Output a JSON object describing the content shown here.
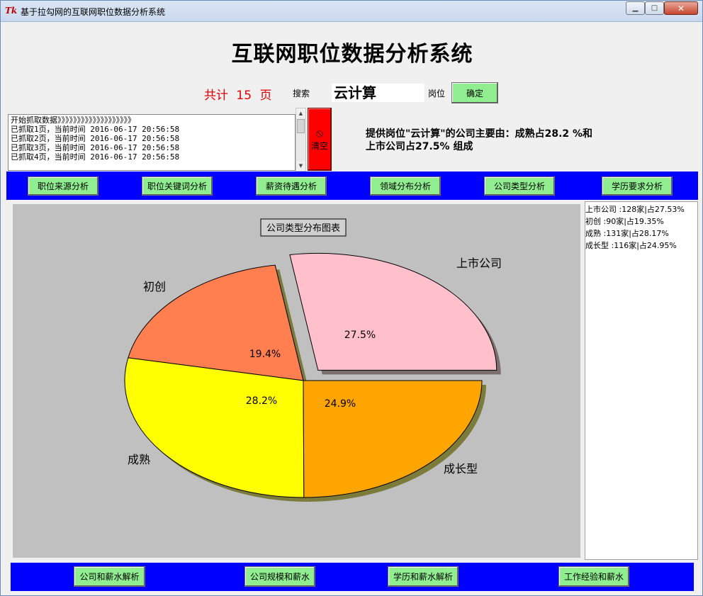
{
  "window": {
    "title": "基于拉勾网的互联网职位数据分析系统",
    "icon_label": "Tk",
    "controls": {
      "minimize": "▁",
      "maximize": "□",
      "close": "✕"
    }
  },
  "header": {
    "title": "互联网职位数据分析系统"
  },
  "search": {
    "page_count": "共计 15 页",
    "search_label": "搜索",
    "query_value": "云计算",
    "position_label": "岗位",
    "confirm_label": "确定"
  },
  "log": {
    "lines": [
      "开始抓取数据》》》》》》》》》》》》》》》》》》》",
      "已抓取1页，当前时间 2016-06-17 20:56:58",
      "已抓取2页，当前时间 2016-06-17 20:56:58",
      "已抓取3页，当前时间 2016-06-17 20:56:58",
      "已抓取4页，当前时间 2016-06-17 20:56:58"
    ],
    "clear_label": "清空"
  },
  "summary": {
    "line1": "提供岗位\"云计算\"的公司主要由：成熟占28.2 %和",
    "line2": "上市公司占27.5% 组成"
  },
  "nav": {
    "items": [
      "职位来源分析",
      "职位关键词分析",
      "薪资待遇分析",
      "领域分布分析",
      "公司类型分析",
      "学历要求分析"
    ]
  },
  "chart_data": {
    "type": "pie",
    "title": "公司类型分布图表",
    "slices": [
      {
        "label": "上市公司",
        "value": 128,
        "percent_label": "27.5%",
        "color": "#ffc0cb",
        "exploded": true
      },
      {
        "label": "初创",
        "value": 90,
        "percent_label": "19.4%",
        "color": "#ff7f50",
        "exploded": false
      },
      {
        "label": "成熟",
        "value": 131,
        "percent_label": "28.2%",
        "color": "#ffff00",
        "exploded": false
      },
      {
        "label": "成长型",
        "value": 116,
        "percent_label": "24.9%",
        "color": "#ffa500",
        "exploded": false
      }
    ],
    "background": "#c0c0c0"
  },
  "legend": {
    "items": [
      "上市公司 :128家|占27.53%",
      "初创 :90家|占19.35%",
      "成熟 :131家|占28.17%",
      "成长型 :116家|占24.95%"
    ]
  },
  "bottom": {
    "items": [
      "公司和薪水解析",
      "公司规模和薪水",
      "学历和薪水解析",
      "工作经验和薪水"
    ]
  },
  "colors": {
    "nav_bar": "#0000ff",
    "button_green": "#90ee90",
    "clear_button": "#ff0000",
    "page_count": "#e00000"
  }
}
